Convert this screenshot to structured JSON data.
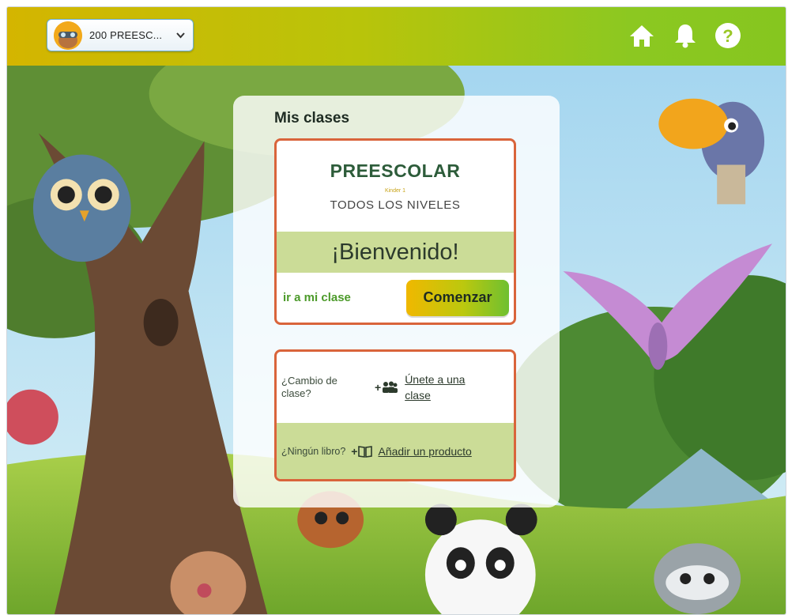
{
  "header": {
    "class_selector": {
      "label": "200 PREESC...",
      "avatar_icon": "bear-avatar-icon",
      "chevron": "chevron-down-icon"
    },
    "icons": [
      "home-icon",
      "bell-icon",
      "help-icon"
    ],
    "colors": {
      "bar_left": "#d4b500",
      "bar_right": "#86c61f"
    }
  },
  "panel": {
    "title": "Mis clases",
    "class_card": {
      "course_title": "PREESCOLAR",
      "course_sub": "Kinder 1",
      "course_level": "TODOS LOS NIVELES",
      "welcome": "¡Bienvenido!",
      "goto_label": "ir a mi clase",
      "start_button": "Comenzar"
    },
    "actions_card": {
      "change_question": "¿Cambio de clase?",
      "join_icon_text": "+",
      "join_link": "Únete a una clase",
      "nobook_question": "¿Ningún libro?",
      "add_icon_text": "+",
      "add_link": "Añadir un producto"
    },
    "colors": {
      "card_border": "#d9643b",
      "band": "#cbdc97",
      "title_green": "#2d5c3a"
    }
  }
}
